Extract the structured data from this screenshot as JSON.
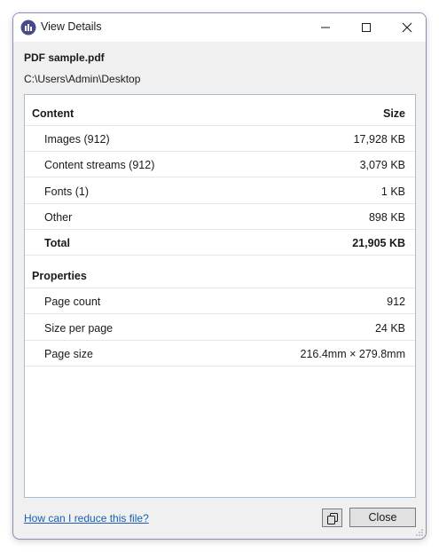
{
  "window": {
    "title": "View Details",
    "accent": "#1a5fb4"
  },
  "file": {
    "name": "PDF sample.pdf",
    "path": "C:\\Users\\Admin\\Desktop"
  },
  "content": {
    "header_label": "Content",
    "header_value": "Size",
    "rows": [
      {
        "label": "Images (912)",
        "value": "17,928 KB"
      },
      {
        "label": "Content streams (912)",
        "value": "3,079 KB"
      },
      {
        "label": "Fonts (1)",
        "value": "1 KB"
      },
      {
        "label": "Other",
        "value": "898 KB"
      }
    ],
    "total_label": "Total",
    "total_value": "21,905 KB"
  },
  "properties": {
    "header_label": "Properties",
    "rows": [
      {
        "label": "Page count",
        "value": "912"
      },
      {
        "label": "Size per page",
        "value": "24 KB"
      },
      {
        "label": "Page size",
        "value": "216.4mm × 279.8mm"
      }
    ]
  },
  "footer": {
    "link_text": "How can I reduce this file?",
    "close_label": "Close",
    "copy_icon": "copy-icon"
  }
}
